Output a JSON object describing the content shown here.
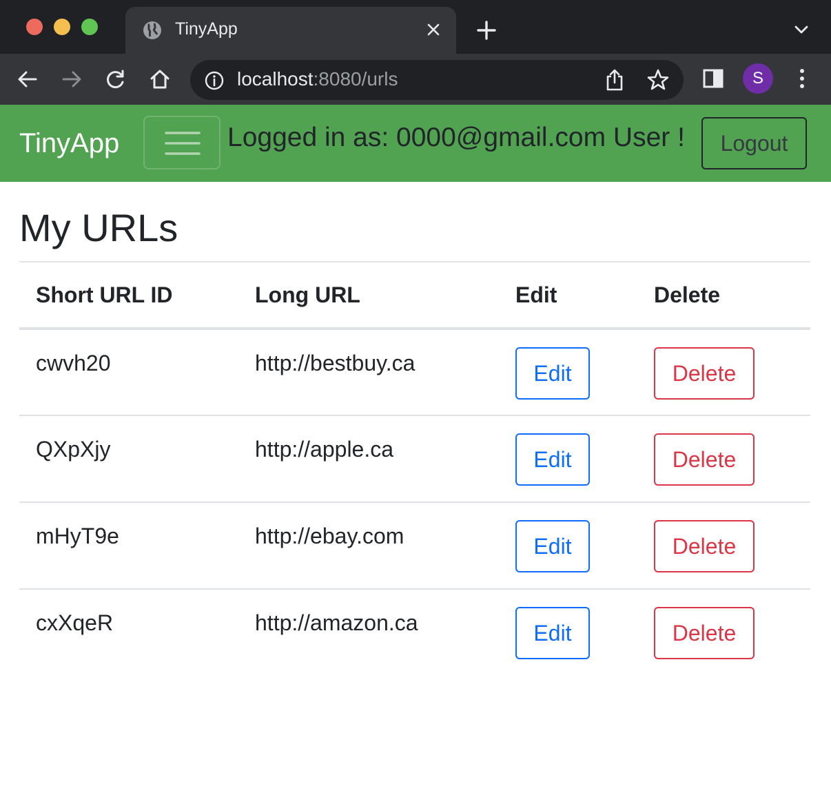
{
  "browser": {
    "tab_title": "TinyApp",
    "url_host": "localhost",
    "url_rest": ":8080/urls",
    "profile_initial": "S",
    "profile_color": "#6f2da8"
  },
  "navbar": {
    "brand": "TinyApp",
    "logged_in_text": "Logged in as: 0000@gmail.com User !",
    "logout_label": "Logout",
    "background": "#51a351"
  },
  "main": {
    "title": "My URLs",
    "columns": [
      "Short URL ID",
      "Long URL",
      "Edit",
      "Delete"
    ],
    "rows": [
      {
        "id": "cwvh20",
        "long_url": "http://bestbuy.ca",
        "edit_label": "Edit",
        "delete_label": "Delete"
      },
      {
        "id": "QXpXjy",
        "long_url": "http://apple.ca",
        "edit_label": "Edit",
        "delete_label": "Delete"
      },
      {
        "id": "mHyT9e",
        "long_url": "http://ebay.com",
        "edit_label": "Edit",
        "delete_label": "Delete"
      },
      {
        "id": "cxXqeR",
        "long_url": "http://amazon.ca",
        "edit_label": "Edit",
        "delete_label": "Delete"
      }
    ]
  },
  "colors": {
    "edit": "#0d6efd",
    "delete": "#dc3545"
  }
}
